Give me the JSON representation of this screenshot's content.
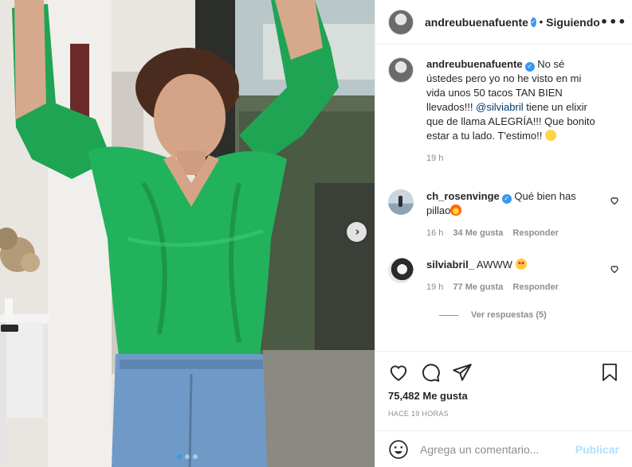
{
  "header": {
    "username": "andreubuenafuente",
    "separator": "•",
    "follow_status": "Siguiendo",
    "more_label": "•••"
  },
  "caption": {
    "username": "andreubuenafuente",
    "text_1": "No sé ústedes pero yo no he visto en mi vida unos 50 tacos TAN BIEN llevados!!!",
    "mention": "@silviabril",
    "text_2": "tiene un elixir que de llama ALEGRÍA!!! Que bonito estar a tu lado. T'estimo!!",
    "time": "19 h"
  },
  "comments": [
    {
      "username": "ch_rosenvinge",
      "verified": true,
      "text": "Qué bien has pillao",
      "time": "16 h",
      "likes": "34 Me gusta",
      "reply": "Responder"
    },
    {
      "username": "silviabril_",
      "verified": false,
      "text": "AWWW",
      "time": "19 h",
      "likes": "77 Me gusta",
      "reply": "Responder",
      "view_replies": "Ver respuestas (5)"
    }
  ],
  "stats": {
    "likes": "75,482 Me gusta",
    "posted": "HACE 19 HORAS"
  },
  "add_comment": {
    "placeholder": "Agrega un comentario...",
    "publish": "Publicar"
  },
  "carousel": {
    "slides": 3,
    "active": 0,
    "next_glyph": "›"
  },
  "colors": {
    "verified": "#3897f0",
    "publish_disabled": "#b2dffc",
    "shirt": "#1fa454"
  },
  "icons": [
    "heart-icon",
    "comment-icon",
    "share-icon",
    "bookmark-icon",
    "emoji-icon",
    "verified-icon",
    "more-icon"
  ]
}
